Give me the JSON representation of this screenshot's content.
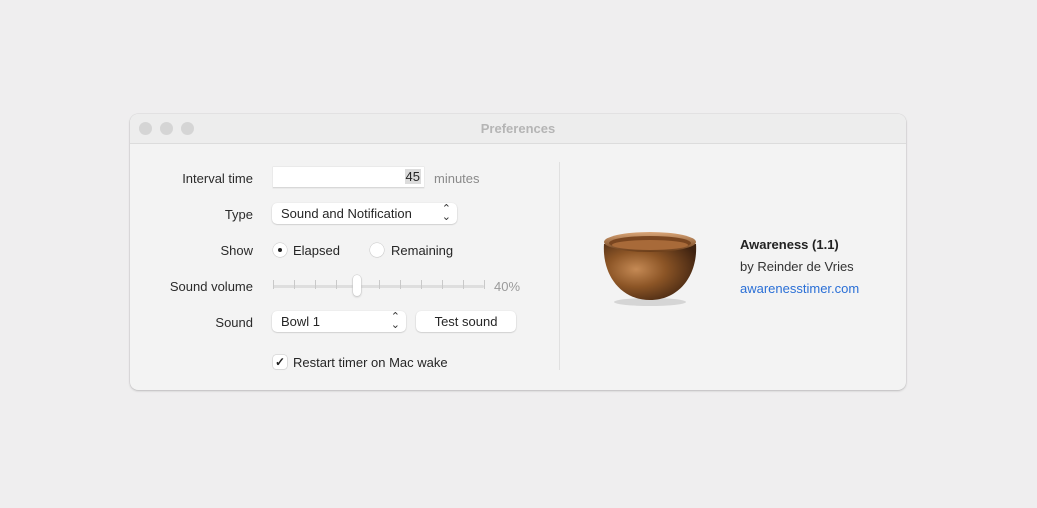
{
  "window": {
    "title": "Preferences"
  },
  "form": {
    "interval_label": "Interval time",
    "interval_value": "45",
    "interval_unit": "minutes",
    "type_label": "Type",
    "type_value": "Sound and Notification",
    "show_label": "Show",
    "show_options": [
      {
        "label": "Elapsed",
        "selected": true
      },
      {
        "label": "Remaining",
        "selected": false
      }
    ],
    "volume_label": "Sound volume",
    "volume_percent": 40,
    "volume_text": "40%",
    "sound_label": "Sound",
    "sound_value": "Bowl 1",
    "test_sound_label": "Test sound",
    "restart_label": "Restart timer on Mac wake",
    "restart_checked": true
  },
  "about": {
    "app_name": "Awareness (1.1)",
    "author": "by Reinder de Vries",
    "link": "awarenesstimer.com",
    "link_color": "#2a6fd6",
    "image": "singing-bowl"
  },
  "icons": {
    "chevron": "⌃⌄",
    "check": "✓"
  }
}
